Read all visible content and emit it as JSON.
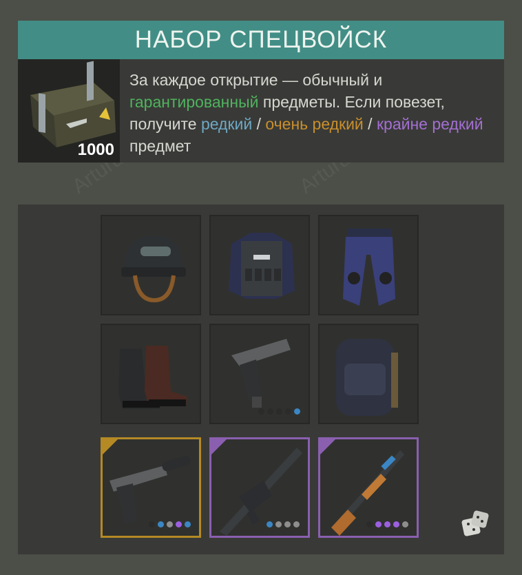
{
  "watermark": "Arturus",
  "kit": {
    "title": "НАБОР СПЕЦВОЙСК",
    "crate_icon": "military-crate-icon",
    "count": "1000",
    "description": {
      "part1": "За каждое открытие — обычный и",
      "guaranteed": "гарантированный",
      "part2": " предметы. Если повезет, получите ",
      "rare": "редкий",
      "sep1": " / ",
      "very_rare": "очень редкий",
      "sep2": " / ",
      "extremely_rare": "крайне редкий",
      "part3": " предмет"
    }
  },
  "colors": {
    "guaranteed": "#4fb35e",
    "rare": "#6fa8c4",
    "very_rare": "#c98f2c",
    "extremely_rare": "#a46fd3"
  },
  "items": [
    {
      "icon": "tactical-helmet-icon",
      "rarity": "common",
      "dots": []
    },
    {
      "icon": "police-vest-icon",
      "rarity": "common",
      "dots": []
    },
    {
      "icon": "tactical-pants-icon",
      "rarity": "common",
      "dots": []
    },
    {
      "icon": "combat-boots-icon",
      "rarity": "common",
      "dots": []
    },
    {
      "icon": "pistol-icon",
      "rarity": "common",
      "dots": [
        "#2b2c2a",
        "#2b2c2a",
        "#2b2c2a",
        "#2b2c2a",
        "#3b86c4"
      ]
    },
    {
      "icon": "tactical-backpack-icon",
      "rarity": "common",
      "dots": []
    },
    {
      "icon": "silenced-pistol-icon",
      "rarity": "very_rare",
      "dots": [
        "#2b2c2a",
        "#3b86c4",
        "#8e8e8e",
        "#9b5fe0",
        "#3b86c4"
      ]
    },
    {
      "icon": "m4-rifle-icon",
      "rarity": "extremely_rare",
      "dots": [
        "#3b86c4",
        "#8e8e8e",
        "#8e8e8e",
        "#8e8e8e"
      ]
    },
    {
      "icon": "akm-rifle-icon",
      "rarity": "extremely_rare",
      "dots": [
        "#2b2c2a",
        "#9b5fe0",
        "#9b5fe0",
        "#9b5fe0",
        "#8e8e8e"
      ]
    }
  ],
  "dice_icon": "dice-icon"
}
